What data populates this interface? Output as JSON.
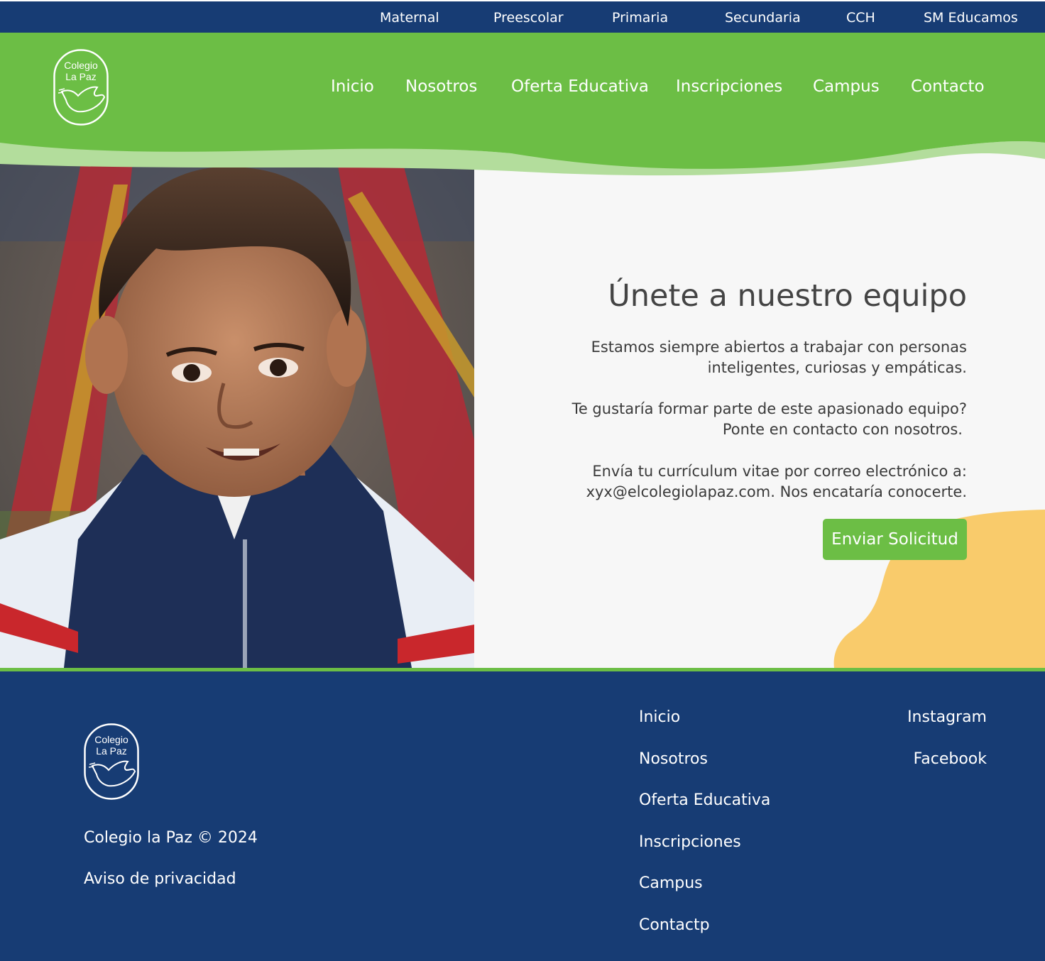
{
  "colors": {
    "navy": "#173c74",
    "green": "#6cbe45",
    "light_green": "#b3dd9c",
    "yellow": "#f9cb6b",
    "panel": "#f7f7f7"
  },
  "topbar": {
    "links": [
      "Maternal",
      "Preescolar",
      "Primaria",
      "Secundaria",
      "CCH",
      "SM Educamos"
    ]
  },
  "logo": {
    "line1": "Colegio",
    "line2": "La Paz",
    "icon": "dove-icon"
  },
  "nav": {
    "links": [
      "Inicio",
      "Nosotros",
      "Oferta Educativa",
      "Inscripciones",
      "Campus",
      "Contacto"
    ]
  },
  "hero": {
    "image_alt": "boy-photo",
    "title": "Únete a nuestro equipo",
    "p1_l1": "Estamos siempre abiertos a trabajar con personas",
    "p1_l2": "inteligentes, curiosas y empáticas.",
    "p2_l1": "Te gustaría formar parte de este apasionado equipo?",
    "p2_l2": "Ponte en contacto con nosotros.",
    "p3_l1": "Envía tu currículum vitae por correo electrónico a:",
    "p3_l2": "xyx@elcolegiolapaz.com. Nos encataría conocerte.",
    "button": "Enviar Solicitud"
  },
  "footer": {
    "copyright": "Colegio la Paz © 2024",
    "privacy": "Aviso de privacidad",
    "nav": [
      "Inicio",
      "Nosotros",
      "Oferta Educativa",
      "Inscripciones",
      "Campus",
      "Contactp"
    ],
    "social": [
      "Instagram",
      "Facebook"
    ]
  }
}
